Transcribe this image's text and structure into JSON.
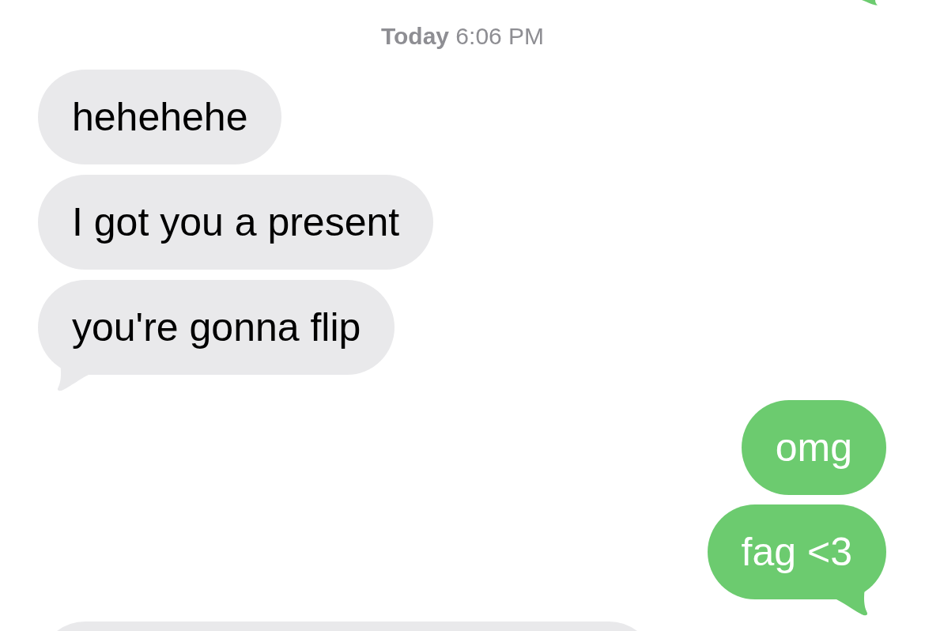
{
  "timestamp": "**Today** 6:06 PM",
  "messages": [
    {
      "kind": "received",
      "text": "hehehehe"
    },
    {
      "kind": "received",
      "text": "I got you a present"
    },
    {
      "kind": "received",
      "text": "you're gonna flip"
    },
    {
      "kind": "sent",
      "text": "omg"
    },
    {
      "kind": "sent",
      "text": "fag <3"
    }
  ]
}
